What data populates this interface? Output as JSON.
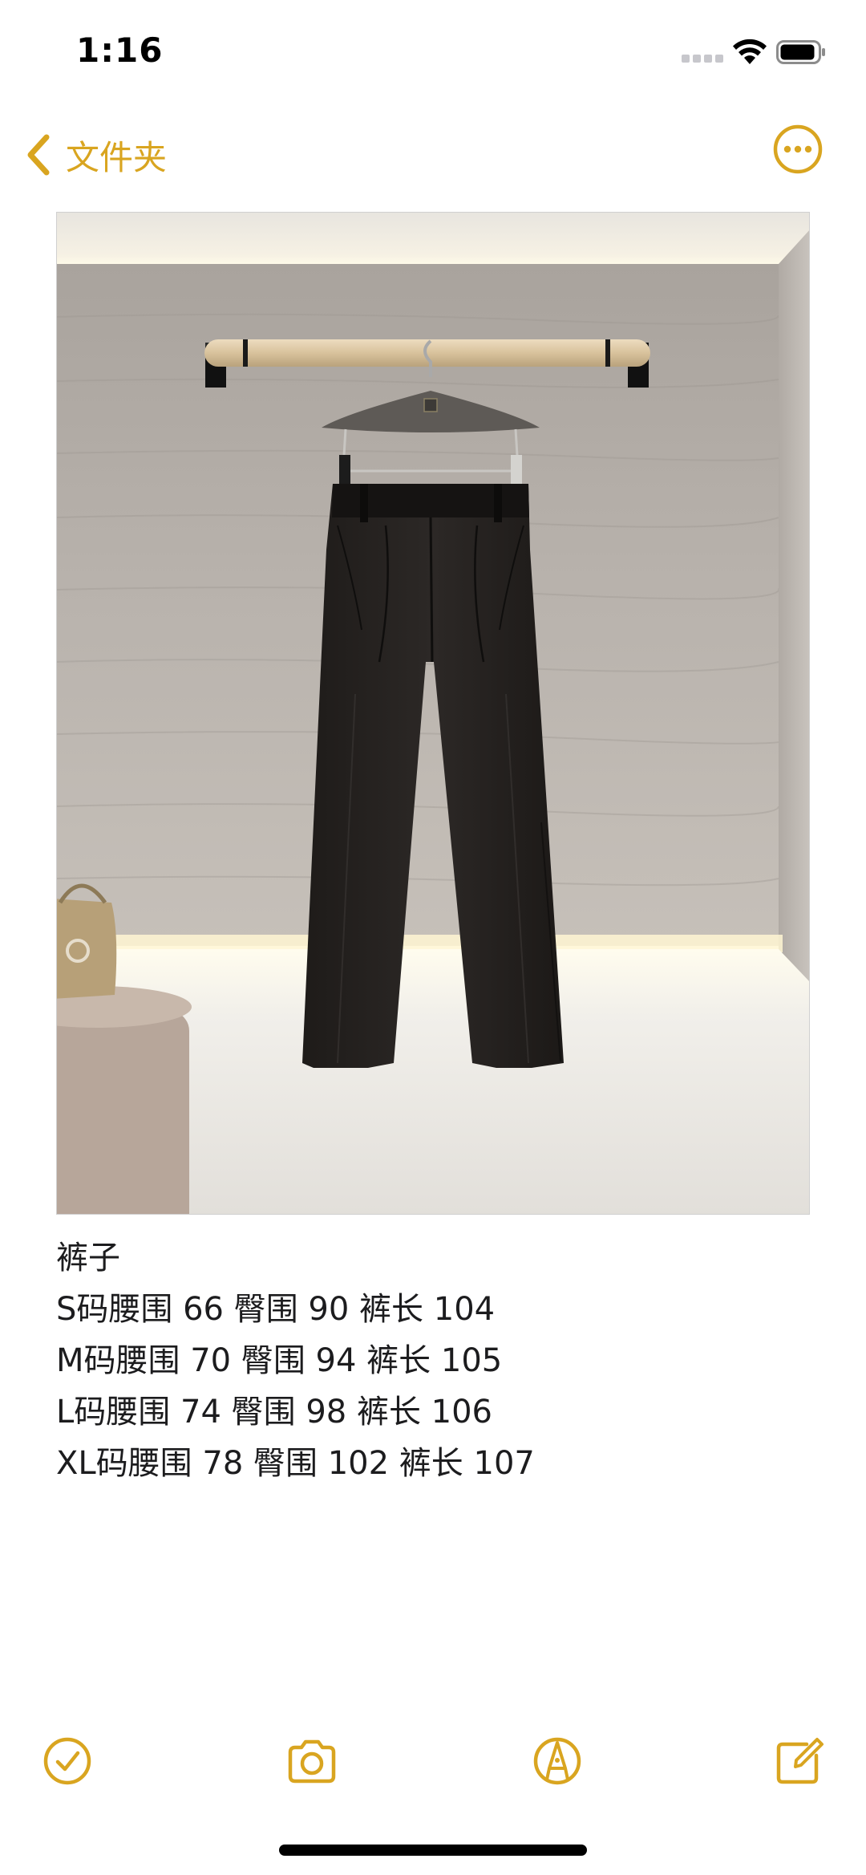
{
  "status_bar": {
    "time": "1:16"
  },
  "nav": {
    "back_label": "文件夹",
    "back_icon": "chevron-left-icon",
    "more_icon": "ellipsis-circle-icon"
  },
  "colors": {
    "accent": "#D9A520",
    "text": "#1C1C1E",
    "background": "#FFFFFF"
  },
  "note": {
    "lines": [
      "裤子",
      "S码腰围 66 臀围 90 裤长 104",
      "M码腰围 70 臀围 94 裤长 105",
      "L码腰围 74 臀围 98 裤长 106",
      "XL码腰围 78 臀围 102 裤长 107"
    ]
  },
  "toolbar": {
    "checklist_icon": "checkmark-circle-icon",
    "camera_icon": "camera-icon",
    "markup_icon": "pen-circle-icon",
    "compose_icon": "compose-icon"
  }
}
